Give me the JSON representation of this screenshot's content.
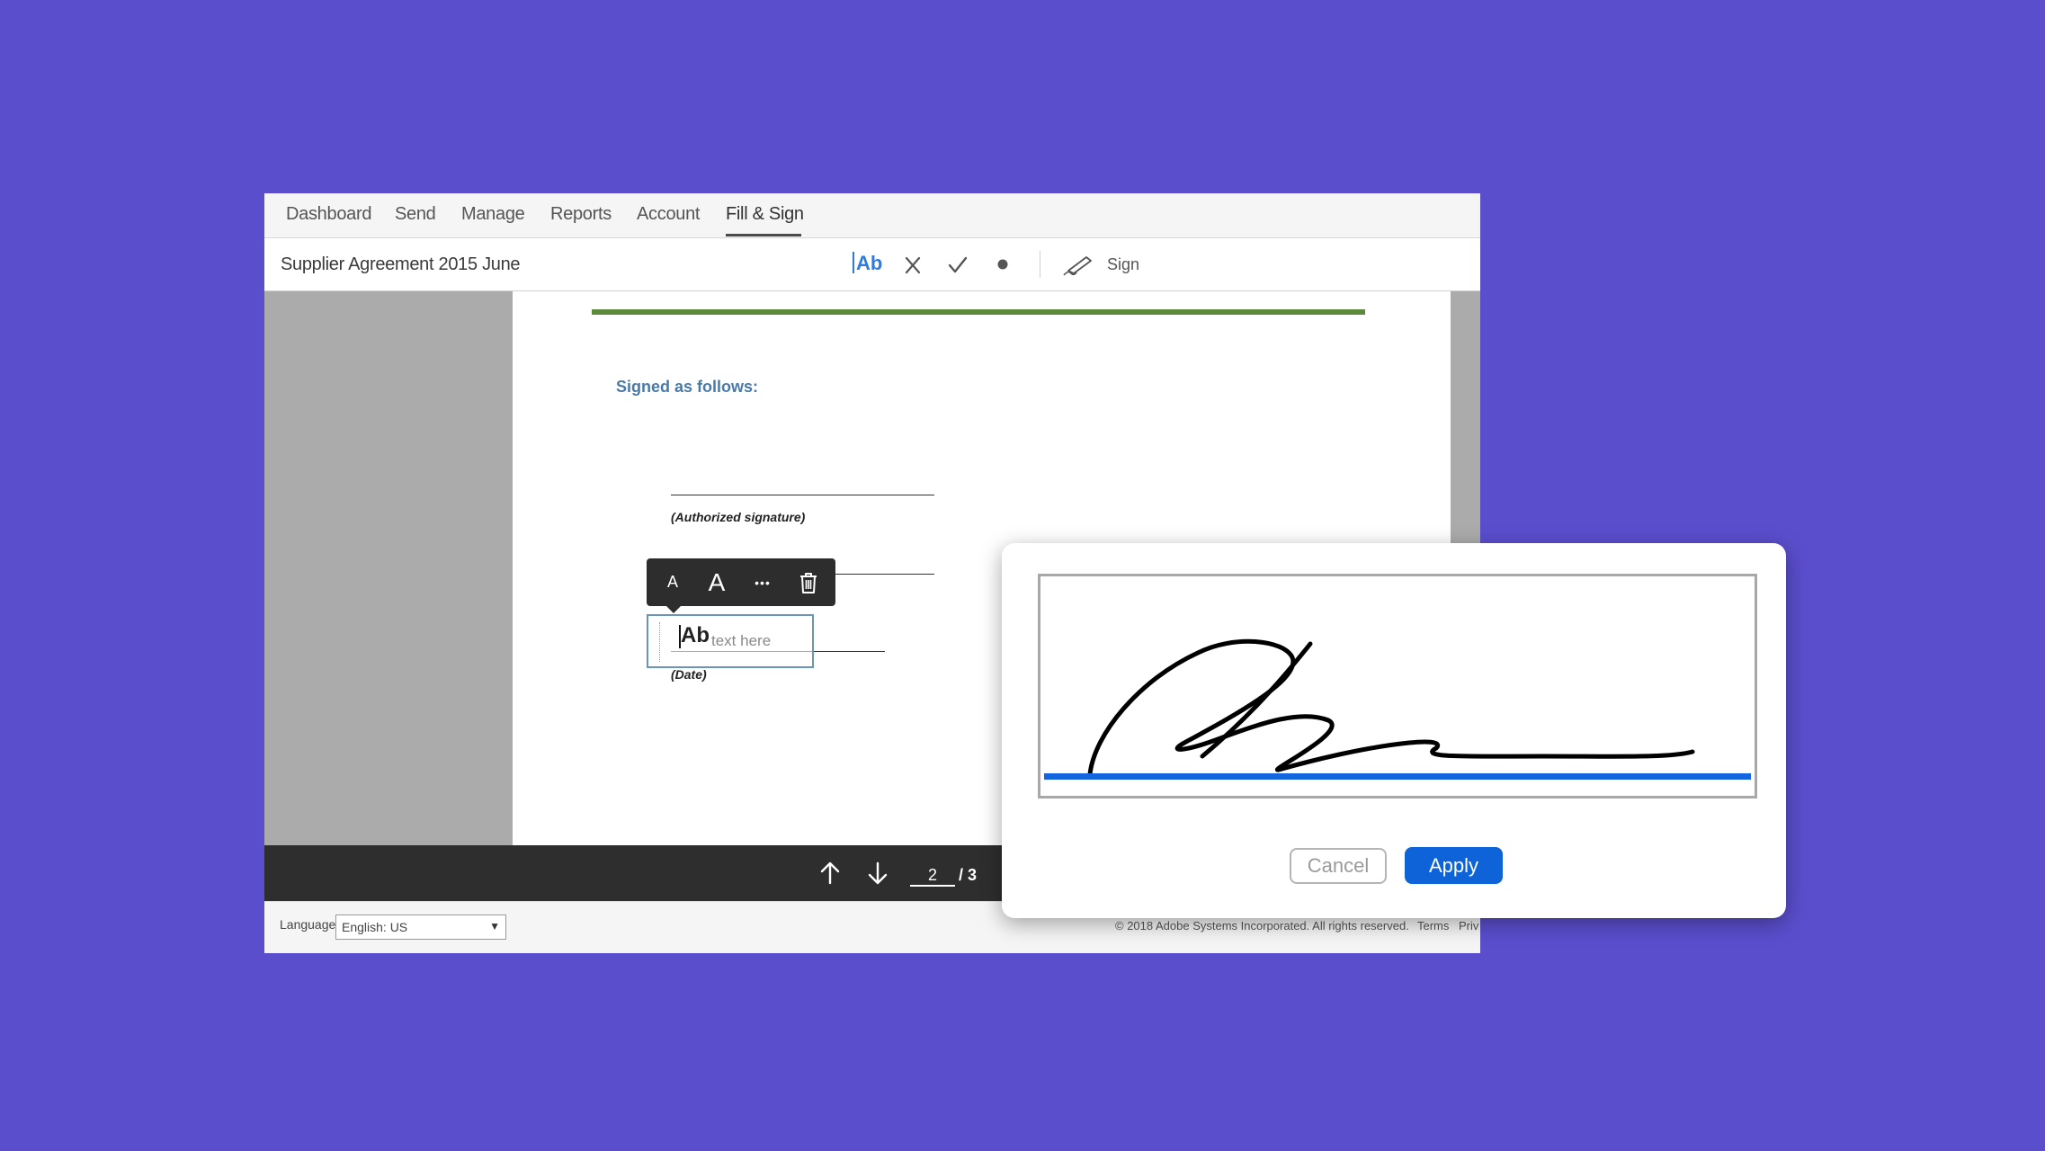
{
  "nav": {
    "items": [
      {
        "label": "Dashboard"
      },
      {
        "label": "Send"
      },
      {
        "label": "Manage"
      },
      {
        "label": "Reports"
      },
      {
        "label": "Account"
      },
      {
        "label": "Fill & Sign"
      }
    ],
    "active": "Fill & Sign"
  },
  "toolbar": {
    "document_title": "Supplier Agreement 2015 June",
    "text_tool_label": "Ab",
    "cross_icon": "cross-mark-icon",
    "check_icon": "checkmark-icon",
    "dot_icon": "dot-icon",
    "sign_icon": "pen-sign-icon",
    "sign_label": "Sign",
    "accent_color": "#2d7be0"
  },
  "document": {
    "heading": "Signed as follows:",
    "authorized_label": "(Authorized signature)",
    "date_label": "(Date)",
    "heading_color": "#4a7aa8",
    "rule_color": "#5a8a3a"
  },
  "text_box_toolbar": {
    "small_font_label": "A",
    "large_font_label": "A",
    "more_label": "•••",
    "delete_icon": "trash-icon"
  },
  "text_field": {
    "tool_label": "Ab",
    "placeholder": "text here"
  },
  "pager": {
    "up_icon": "arrow-up-icon",
    "down_icon": "arrow-down-icon",
    "current_page": "2",
    "total_label": "/ 3"
  },
  "footer": {
    "language_label": "Language",
    "language_value": "English: US",
    "copyright": "© 2018 Adobe Systems Incorporated. All rights reserved.",
    "terms_label": "Terms",
    "privacy_label": "Priv"
  },
  "signature_dialog": {
    "cancel_label": "Cancel",
    "apply_label": "Apply",
    "apply_color": "#0f63d8",
    "baseline_color": "#1466e0"
  }
}
